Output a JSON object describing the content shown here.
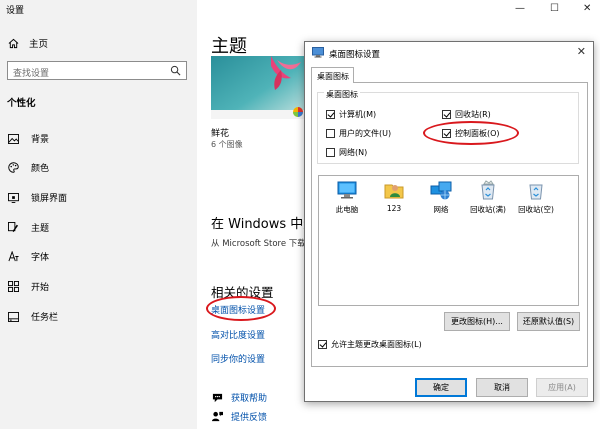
{
  "window": {
    "title": "设置",
    "controls": [
      "—",
      "☐",
      "✕"
    ]
  },
  "sidebar": {
    "home": "主页",
    "search_placeholder": "查找设置",
    "section": "个性化",
    "items": [
      "背景",
      "颜色",
      "锁屏界面",
      "主题",
      "字体",
      "开始",
      "任务栏"
    ]
  },
  "main": {
    "title": "主题",
    "theme_name": "鲜花",
    "theme_count": "6 个图像",
    "store_heading": "在 Windows 中进",
    "store_sub": "从 Microsoft Store 下载",
    "related_heading": "相关的设置",
    "links": [
      "桌面图标设置",
      "高对比度设置",
      "同步你的设置"
    ],
    "help": [
      "获取帮助",
      "提供反馈"
    ]
  },
  "dialog": {
    "title": "桌面图标设置",
    "close": "✕",
    "tab": "桌面图标",
    "group_label": "桌面图标",
    "checkboxes": [
      {
        "label": "计算机(M)",
        "checked": true
      },
      {
        "label": "回收站(R)",
        "checked": true
      },
      {
        "label": "用户的文件(U)",
        "checked": false
      },
      {
        "label": "控制面板(O)",
        "checked": true
      },
      {
        "label": "网络(N)",
        "checked": false
      }
    ],
    "icons": [
      "此电脑",
      "123",
      "网络",
      "回收站(满)",
      "回收站(空)"
    ],
    "change_icon": "更改图标(H)...",
    "restore_default": "还原默认值(S)",
    "allow_themes": {
      "label": "允许主题更改桌面图标(L)",
      "checked": true
    },
    "ok": "确定",
    "cancel": "取消",
    "apply": "应用(A)"
  },
  "colors": {
    "link": "#0050aa",
    "highlight": "#d9181d",
    "accent": "#0078d7"
  }
}
